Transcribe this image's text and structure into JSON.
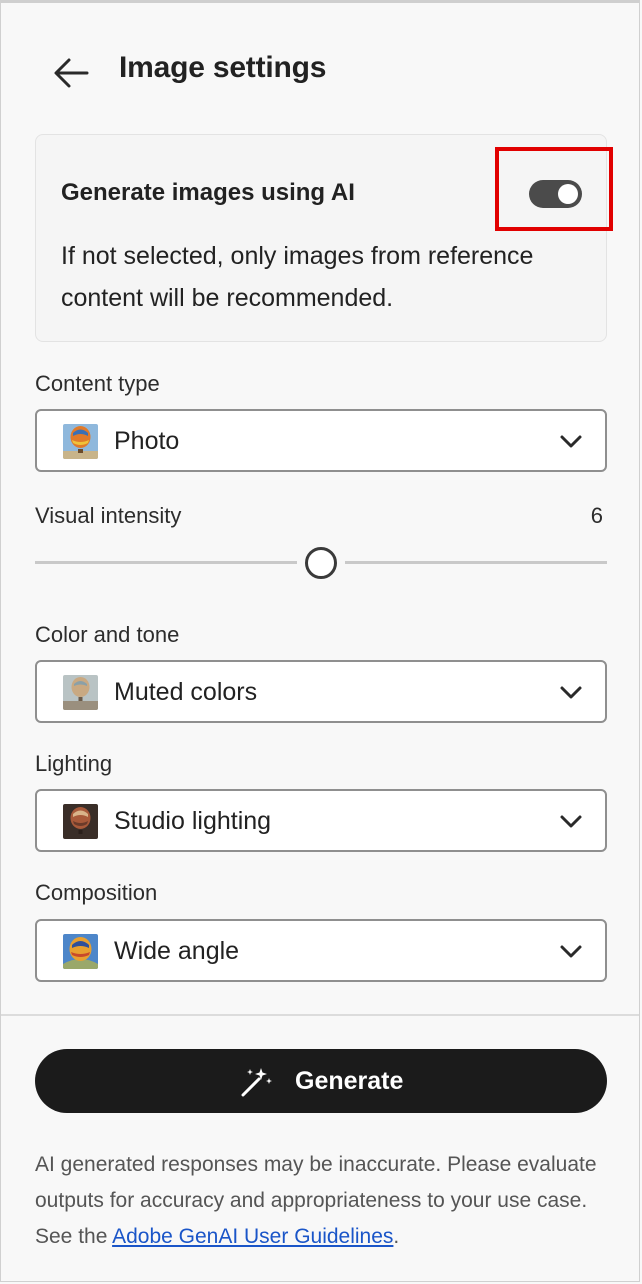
{
  "header": {
    "title": "Image settings",
    "back_icon": "arrow-left-icon"
  },
  "ai_toggle": {
    "title": "Generate images using AI",
    "description": "If not selected, only images from reference content will be recommended.",
    "enabled": true
  },
  "content_type": {
    "label": "Content type",
    "value": "Photo",
    "thumbnail": "hot-air-balloon-photo"
  },
  "visual_intensity": {
    "label": "Visual intensity",
    "value": "6",
    "level": 6
  },
  "color_tone": {
    "label": "Color and tone",
    "value": "Muted colors",
    "thumbnail": "hot-air-balloon-muted"
  },
  "lighting": {
    "label": "Lighting",
    "value": "Studio lighting",
    "thumbnail": "hot-air-balloon-studio"
  },
  "composition": {
    "label": "Composition",
    "value": "Wide angle",
    "thumbnail": "hot-air-balloon-wide"
  },
  "generate": {
    "label": "Generate",
    "icon": "magic-wand-icon"
  },
  "disclaimer": {
    "text": "AI generated responses may be inaccurate. Please evaluate outputs for accuracy and appropriateness to your use case. See the",
    "link": "Adobe GenAI User Guidelines",
    "suffix": "."
  },
  "colors": {
    "toggle_on": "#4b4b4b",
    "highlight": "#e10000",
    "button": "#1b1b1b",
    "link": "#1a55c8"
  }
}
